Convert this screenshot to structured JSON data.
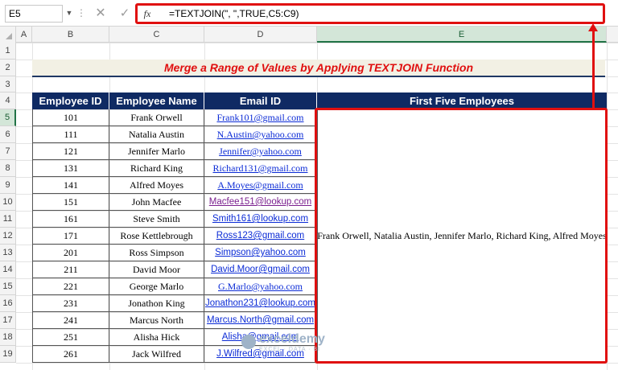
{
  "formula_bar": {
    "name_box": "E5",
    "formula": "=TEXTJOIN(\", \",TRUE,C5:C9)",
    "fx_label": "fx"
  },
  "columns": [
    "A",
    "B",
    "C",
    "D",
    "E"
  ],
  "rows": [
    "1",
    "2",
    "3",
    "4",
    "5",
    "6",
    "7",
    "8",
    "9",
    "10",
    "11",
    "12",
    "13",
    "14",
    "15",
    "16",
    "17",
    "18",
    "19"
  ],
  "title": "Merge a Range of Values by Applying TEXTJOIN Function",
  "table": {
    "headers": [
      "Employee ID",
      "Employee Name",
      "Email ID",
      "First Five Employees"
    ],
    "rows": [
      {
        "id": "101",
        "name": "Frank Orwell",
        "email": "Frank101@gmail.com"
      },
      {
        "id": "111",
        "name": "Natalia Austin",
        "email": "N.Austin@yahoo.com"
      },
      {
        "id": "121",
        "name": "Jennifer Marlo",
        "email": "Jennifer@yahoo.com"
      },
      {
        "id": "131",
        "name": "Richard King",
        "email": "Richard131@gmail.com"
      },
      {
        "id": "141",
        "name": "Alfred Moyes",
        "email": "A.Moyes@gmail.com"
      },
      {
        "id": "151",
        "name": "John Macfee",
        "email": "Macfee151@lookup.com"
      },
      {
        "id": "161",
        "name": "Steve Smith",
        "email": "Smith161@lookup.com"
      },
      {
        "id": "171",
        "name": "Rose Kettlebrough",
        "email": "Ross123@gmail.com"
      },
      {
        "id": "201",
        "name": "Ross Simpson",
        "email": "Simpson@yahoo.com"
      },
      {
        "id": "211",
        "name": "David Moor",
        "email": "David.Moor@gmail.com"
      },
      {
        "id": "221",
        "name": "George Marlo",
        "email": "G.Marlo@yahoo.com"
      },
      {
        "id": "231",
        "name": "Jonathon King",
        "email": "Jonathon231@lookup.com"
      },
      {
        "id": "241",
        "name": "Marcus North",
        "email": "Marcus.North@gmail.com"
      },
      {
        "id": "251",
        "name": "Alisha Hick",
        "email": "Alisha@gmail.com"
      },
      {
        "id": "261",
        "name": "Jack Wilfred",
        "email": "J.Wilfred@gmail.com"
      }
    ],
    "result": "Frank Orwell, Natalia Austin, Jennifer Marlo, Richard King, Alfred Moyes"
  },
  "watermark": {
    "name": "exceldemy",
    "tagline": "EXCEL · DATA · BI"
  },
  "colors": {
    "accent_red": "#e01010",
    "header_navy": "#0f2a63",
    "link_blue": "#0b2bd6"
  }
}
